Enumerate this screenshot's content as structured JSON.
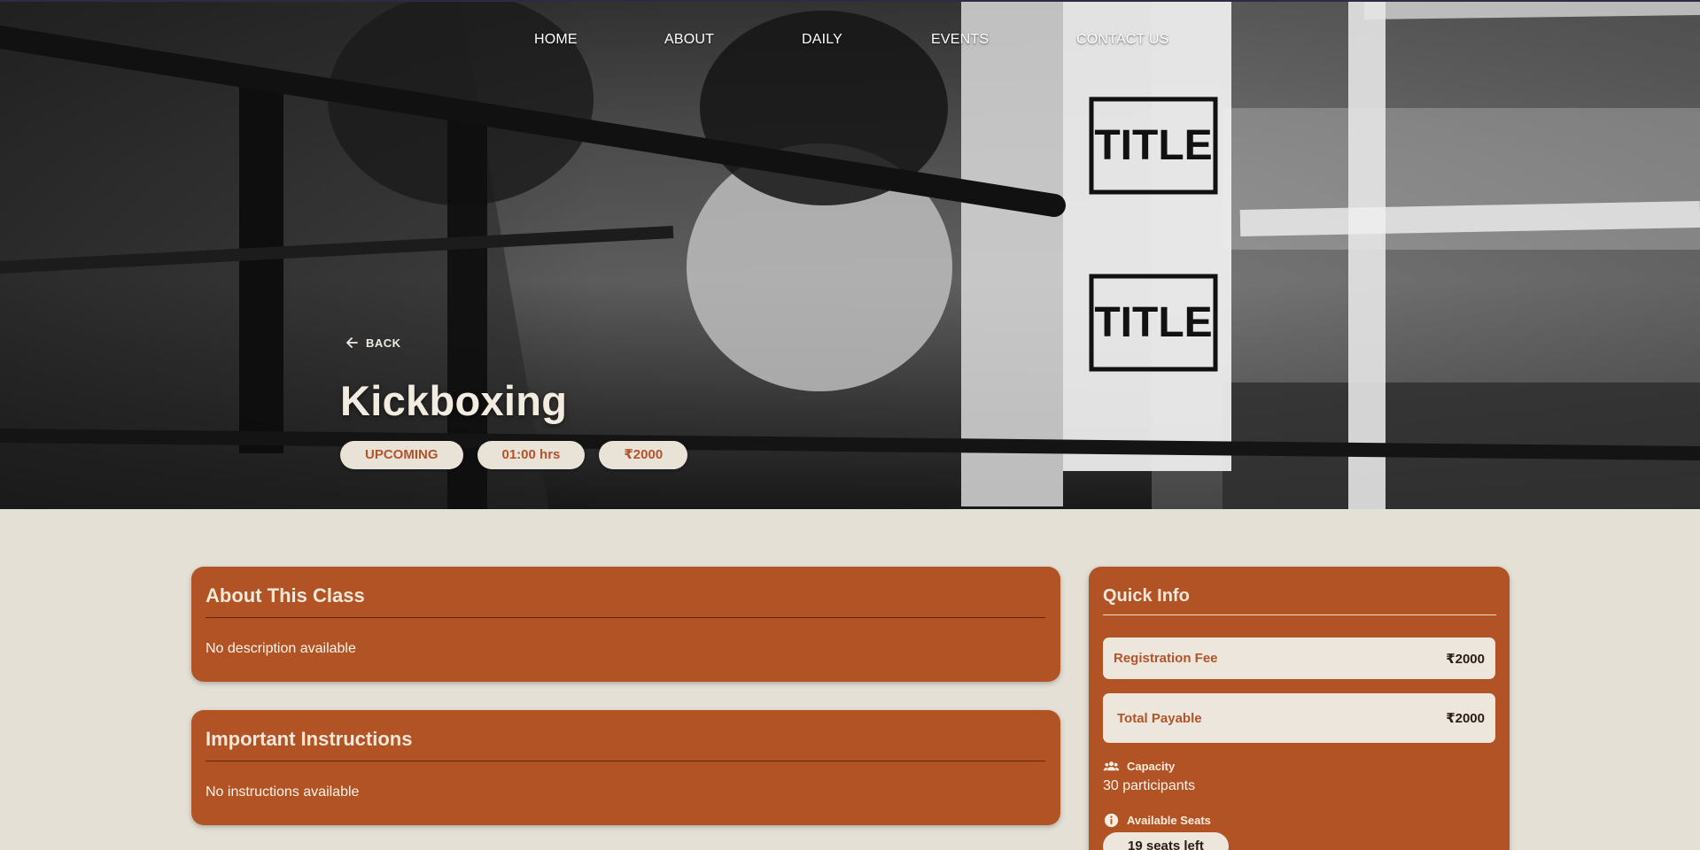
{
  "nav": {
    "items": [
      "HOME",
      "ABOUT",
      "DAILY",
      "EVENTS",
      "CONTACT US"
    ]
  },
  "hero": {
    "back_label": "BACK",
    "title": "Kickboxing",
    "chips": {
      "status": "UPCOMING",
      "duration": "01:00 hrs",
      "price": "₹2000"
    }
  },
  "about": {
    "heading": "About This Class",
    "body": "No description available"
  },
  "instructions": {
    "heading": "Important Instructions",
    "body": "No instructions available"
  },
  "quick_info": {
    "heading": "Quick Info",
    "registration_fee_label": "Registration Fee",
    "registration_fee_value": "₹2000",
    "total_payable_label": "Total Payable",
    "total_payable_value": "₹2000",
    "capacity_label": "Capacity",
    "capacity_value": "30 participants",
    "available_seats_label": "Available Seats",
    "available_seats_value": "19 seats left"
  },
  "colors": {
    "accent": "#b15325",
    "background": "#e4e0d6",
    "chip_bg": "#e8e2d7",
    "chip_text": "#b2532a"
  },
  "icons": [
    "arrow-left-icon",
    "people-icon",
    "info-icon"
  ]
}
